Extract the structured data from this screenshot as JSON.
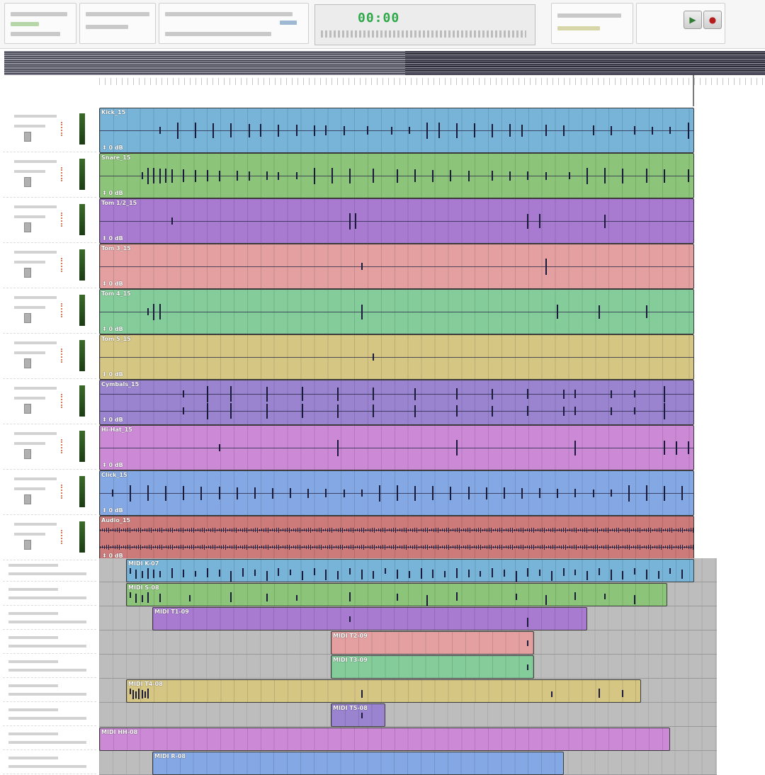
{
  "transport": {
    "main_counter": "00:00",
    "colors": {
      "counter_text": "#2fa84a",
      "play": "#2e7d32",
      "record": "#b71c1c"
    },
    "buttons": [
      {
        "icon": "play-icon",
        "glyph": "▶"
      },
      {
        "icon": "record-icon",
        "glyph": "●"
      }
    ]
  },
  "clip_gain_label": "0 dB",
  "audio_tracks": [
    {
      "name": "Kick_15",
      "color": "#78b4d8",
      "hits": [
        0.1,
        0.13,
        0.16,
        0.19,
        0.22,
        0.25,
        0.27,
        0.3,
        0.33,
        0.36,
        0.38,
        0.41,
        0.45,
        0.49,
        0.52,
        0.55,
        0.57,
        0.6,
        0.63,
        0.66,
        0.69,
        0.71,
        0.75,
        0.78,
        0.83,
        0.86,
        0.9,
        0.93,
        0.96,
        0.99
      ]
    },
    {
      "name": "Snare_15",
      "color": "#8cc47a",
      "hits": [
        0.07,
        0.08,
        0.09,
        0.1,
        0.11,
        0.12,
        0.14,
        0.16,
        0.18,
        0.2,
        0.23,
        0.25,
        0.28,
        0.3,
        0.33,
        0.36,
        0.39,
        0.42,
        0.46,
        0.5,
        0.53,
        0.56,
        0.59,
        0.62,
        0.66,
        0.69,
        0.72,
        0.75,
        0.79,
        0.82,
        0.85,
        0.88,
        0.92,
        0.95,
        0.99
      ]
    },
    {
      "name": "Tom 1/2_15",
      "color": "#a87ad0",
      "hits": [
        0.12,
        0.42,
        0.43,
        0.72,
        0.74,
        0.85
      ]
    },
    {
      "name": "Tom 3_15",
      "color": "#e4a0a0",
      "hits": [
        0.44,
        0.75
      ]
    },
    {
      "name": "Tom 4_15",
      "color": "#84cc9a",
      "hits": [
        0.08,
        0.09,
        0.1,
        0.44,
        0.77,
        0.84,
        0.92
      ]
    },
    {
      "name": "Tom 5_15",
      "color": "#d6c684",
      "hits": [
        0.46
      ]
    },
    {
      "name": "Cymbals_15",
      "color": "#9a84d0",
      "hits": [
        0.14,
        0.18,
        0.22,
        0.28,
        0.34,
        0.4,
        0.46,
        0.53,
        0.6,
        0.66,
        0.72,
        0.78,
        0.8,
        0.86,
        0.9,
        0.95
      ]
    },
    {
      "name": "Hi-Hat_15",
      "color": "#cc8ad6",
      "hits": [
        0.2,
        0.4,
        0.6,
        0.8,
        0.95,
        0.97,
        0.99
      ]
    },
    {
      "name": "Click_15",
      "color": "#84a8e4",
      "hits": [
        0.02,
        0.05,
        0.08,
        0.11,
        0.14,
        0.17,
        0.2,
        0.23,
        0.26,
        0.29,
        0.32,
        0.35,
        0.38,
        0.41,
        0.44,
        0.47,
        0.5,
        0.53,
        0.56,
        0.59,
        0.62,
        0.65,
        0.68,
        0.71,
        0.74,
        0.77,
        0.8,
        0.83,
        0.86,
        0.89,
        0.92,
        0.95,
        0.98
      ]
    },
    {
      "name": "Audio_15",
      "color": "#cc7a7a",
      "hits": []
    }
  ],
  "midi_tracks": [
    {
      "name": "MIDI K-07",
      "color": "#78b4d8",
      "start": 0.045,
      "end": 1.0,
      "notes": [
        0.05,
        0.06,
        0.07,
        0.08,
        0.09,
        0.1,
        0.12,
        0.14,
        0.16,
        0.18,
        0.2,
        0.22,
        0.24,
        0.26,
        0.28,
        0.3,
        0.32,
        0.34,
        0.36,
        0.38,
        0.4,
        0.42,
        0.44,
        0.46,
        0.48,
        0.5,
        0.52,
        0.54,
        0.56,
        0.58,
        0.6,
        0.62,
        0.64,
        0.66,
        0.68,
        0.7,
        0.72,
        0.74,
        0.76,
        0.78,
        0.8,
        0.82,
        0.84,
        0.86,
        0.88,
        0.9,
        0.92,
        0.94,
        0.96,
        0.98
      ]
    },
    {
      "name": "MIDI S-08",
      "color": "#8cc47a",
      "start": 0.045,
      "end": 0.955,
      "notes": [
        0.05,
        0.06,
        0.07,
        0.08,
        0.1,
        0.15,
        0.22,
        0.28,
        0.33,
        0.42,
        0.5,
        0.55,
        0.6,
        0.7,
        0.75,
        0.8,
        0.85,
        0.9
      ]
    },
    {
      "name": "MIDI T1-09",
      "color": "#a87ad0",
      "start": 0.09,
      "end": 0.82,
      "notes": [
        0.42,
        0.72
      ]
    },
    {
      "name": "MIDI T2-09",
      "color": "#e4a0a0",
      "start": 0.39,
      "end": 0.73,
      "notes": [
        0.72
      ]
    },
    {
      "name": "MIDI T3-09",
      "color": "#84cc9a",
      "start": 0.39,
      "end": 0.73,
      "notes": [
        0.72
      ]
    },
    {
      "name": "MIDI T4-08",
      "color": "#d6c684",
      "start": 0.045,
      "end": 0.91,
      "notes": [
        0.05,
        0.055,
        0.06,
        0.065,
        0.07,
        0.075,
        0.08,
        0.44,
        0.76,
        0.84,
        0.88
      ]
    },
    {
      "name": "MIDI T5-08",
      "color": "#9a84d0",
      "start": 0.39,
      "end": 0.48,
      "notes": [
        0.44
      ]
    },
    {
      "name": "MIDI HH-08",
      "color": "#cc8ad6",
      "start": 0.0,
      "end": 0.96,
      "notes": []
    },
    {
      "name": "MIDI R-08",
      "color": "#84a8e4",
      "start": 0.09,
      "end": 0.78,
      "notes": []
    }
  ]
}
